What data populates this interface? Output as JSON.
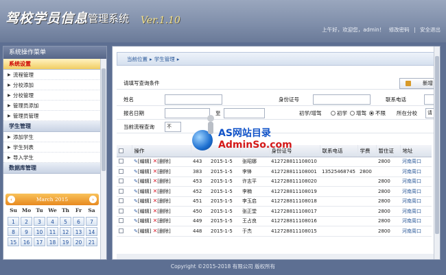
{
  "header": {
    "logo_title": "驾校学员信息",
    "logo_subtitle": "管理系统",
    "version": "Ver.1.10",
    "greeting": "上午好，欢迎您，admin！",
    "change_password": "修改密码",
    "separator": "|",
    "logout": "安全退出"
  },
  "sidebar": {
    "title": "系统操作菜单",
    "groups": [
      {
        "label": "系统设置",
        "items": [
          "流程管理",
          "分校添加",
          "分校管理",
          "管理员添加",
          "管理员管理"
        ]
      },
      {
        "label": "学生管理",
        "items": [
          "添加学生",
          "学生列表",
          "导入学生"
        ]
      },
      {
        "label": "数据库管理",
        "items": []
      }
    ]
  },
  "calendar": {
    "month_label": "March 2015",
    "weekdays": [
      "Su",
      "Mo",
      "Tu",
      "We",
      "Th",
      "Fr",
      "Sa"
    ],
    "days": [
      "1",
      "2",
      "3",
      "4",
      "5",
      "6",
      "7",
      "8",
      "9",
      "10",
      "11",
      "12",
      "13",
      "14",
      "15",
      "16",
      "17",
      "18",
      "19",
      "20",
      "21"
    ]
  },
  "breadcrumb": {
    "location": "当前位置",
    "section": "学生管理"
  },
  "search": {
    "hint": "请填写查询条件",
    "add_button": "新增",
    "name_label": "姓名",
    "id_label": "身份证号",
    "phone_label": "联系电话",
    "signup_date_label": "报名日期",
    "signup_date_to": "至",
    "license_type_label": "初学/增驾",
    "license_options": [
      "初学",
      "增驾",
      "不限"
    ],
    "license_selected": "不限",
    "branch_label": "所在分校",
    "branch_value": "请",
    "flow_label": "当前流程查询",
    "flow_value": "不"
  },
  "table": {
    "columns": [
      "",
      "操作",
      "",
      "",
      "",
      "身份证号",
      "联系电话",
      "学费",
      "暂住证",
      "地址"
    ],
    "edit_label": "[编辑]",
    "delete_label": "[删除]",
    "rows": [
      {
        "no": "443",
        "date": "2015-1-5",
        "name": "张昭娜",
        "id_no": "412728811108010",
        "phone": "",
        "fee": "",
        "permit": "2800",
        "address": "河南周口"
      },
      {
        "no": "383",
        "date": "2015-1-5",
        "name": "李锋",
        "id_no": "412728811108001",
        "phone": "13525468745",
        "fee": "2800",
        "permit": "",
        "address": "河南周口"
      },
      {
        "no": "453",
        "date": "2015-1-5",
        "name": "许志平",
        "id_no": "412728811108020",
        "phone": "",
        "fee": "",
        "permit": "2800",
        "address": "河南周口"
      },
      {
        "no": "452",
        "date": "2015-1-5",
        "name": "李楠",
        "id_no": "412728811108019",
        "phone": "",
        "fee": "",
        "permit": "2800",
        "address": "河南周口"
      },
      {
        "no": "451",
        "date": "2015-1-5",
        "name": "李玉启",
        "id_no": "412728811108018",
        "phone": "",
        "fee": "",
        "permit": "2800",
        "address": "河南周口"
      },
      {
        "no": "450",
        "date": "2015-1-5",
        "name": "张正堂",
        "id_no": "412728811108017",
        "phone": "",
        "fee": "",
        "permit": "2800",
        "address": "河南周口"
      },
      {
        "no": "449",
        "date": "2015-1-5",
        "name": "王占良",
        "id_no": "412728811108016",
        "phone": "",
        "fee": "",
        "permit": "2800",
        "address": "河南周口"
      },
      {
        "no": "448",
        "date": "2015-1-5",
        "name": "于杰",
        "id_no": "412728811108015",
        "phone": "",
        "fee": "",
        "permit": "2800",
        "address": "河南周口"
      }
    ]
  },
  "watermark": {
    "line1": "AS网站目录",
    "line2": "AdminSo.com"
  },
  "footer": "Copyright ©2015-2018 有限公司 版权所有"
}
